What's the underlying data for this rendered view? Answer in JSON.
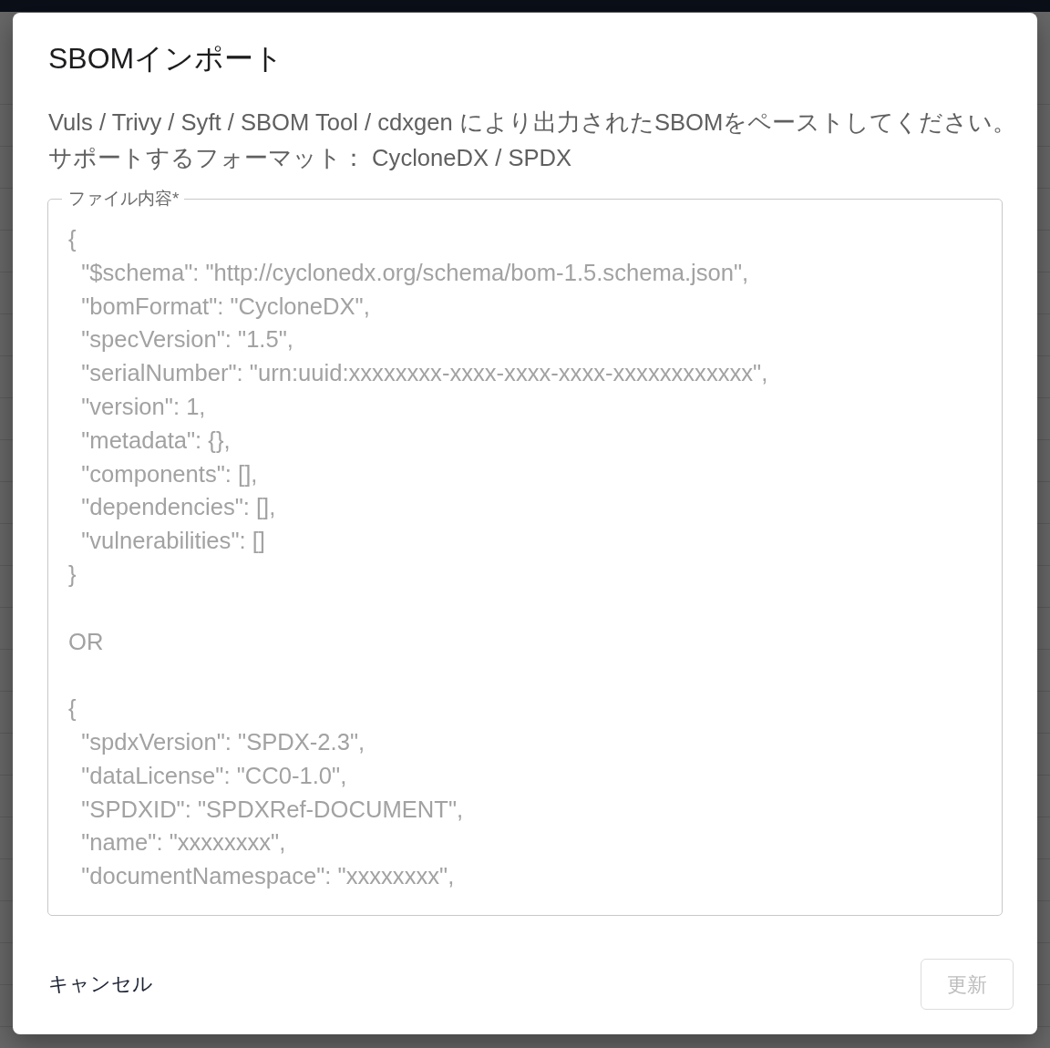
{
  "dialog": {
    "title": "SBOMインポート",
    "description_lines": [
      "Vuls / Trivy / Syft / SBOM Tool / cdxgen により出力されたSBOMをペーストしてください。",
      "サポートするフォーマット： CycloneDX / SPDX"
    ],
    "file_content": {
      "label": "ファイル内容*",
      "placeholder": "{\n  \"$schema\": \"http://cyclonedx.org/schema/bom-1.5.schema.json\",\n  \"bomFormat\": \"CycloneDX\",\n  \"specVersion\": \"1.5\",\n  \"serialNumber\": \"urn:uuid:xxxxxxxx-xxxx-xxxx-xxxx-xxxxxxxxxxxx\",\n  \"version\": 1,\n  \"metadata\": {},\n  \"components\": [],\n  \"dependencies\": [],\n  \"vulnerabilities\": []\n}\n\nOR\n\n{\n  \"spdxVersion\": \"SPDX-2.3\",\n  \"dataLicense\": \"CC0-1.0\",\n  \"SPDXID\": \"SPDXRef-DOCUMENT\",\n  \"name\": \"xxxxxxxx\",\n  \"documentNamespace\": \"xxxxxxxx\","
    },
    "buttons": [
      {
        "kind": "text",
        "label": "キャンセル",
        "disabled": false
      },
      {
        "kind": "outlined",
        "label": "更新",
        "disabled": true
      }
    ]
  }
}
